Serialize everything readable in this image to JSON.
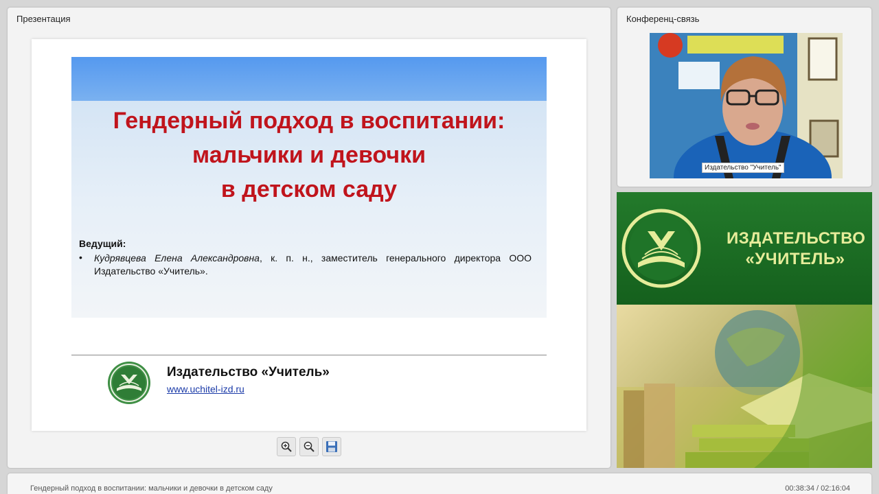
{
  "presentation_panel": {
    "title": "Презентация"
  },
  "slide": {
    "title_lines": [
      "Гендерный подход в воспитании:",
      "мальчики и девочки",
      "в детском саду"
    ],
    "presenter_label": "Ведущий:",
    "bullet": "•",
    "presenter_name": "Кудрявцева Елена Александровна",
    "presenter_details": ", к. п. н., заместитель генерального директора ООО Издательство «Учитель».",
    "publisher_name": "Издательство «Учитель»",
    "publisher_url": "www.uchitel-izd.ru"
  },
  "toolbar": {
    "icons": [
      "zoom-in-icon",
      "zoom-out-icon",
      "save-icon"
    ]
  },
  "conference_panel": {
    "title": "Конференц-связь",
    "video_caption": "Издательство \"Учитель\""
  },
  "ad": {
    "line1": "ИЗДАТЕЛЬСТВО",
    "line2": "«УЧИТЕЛЬ»",
    "colors": {
      "green": "#1c6b24",
      "text": "#e6ec9a"
    }
  },
  "footer": {
    "title": "Гендерный подход в воспитании: мальчики и девочки в детском саду",
    "time": "00:38:34 / 02:16:04"
  }
}
